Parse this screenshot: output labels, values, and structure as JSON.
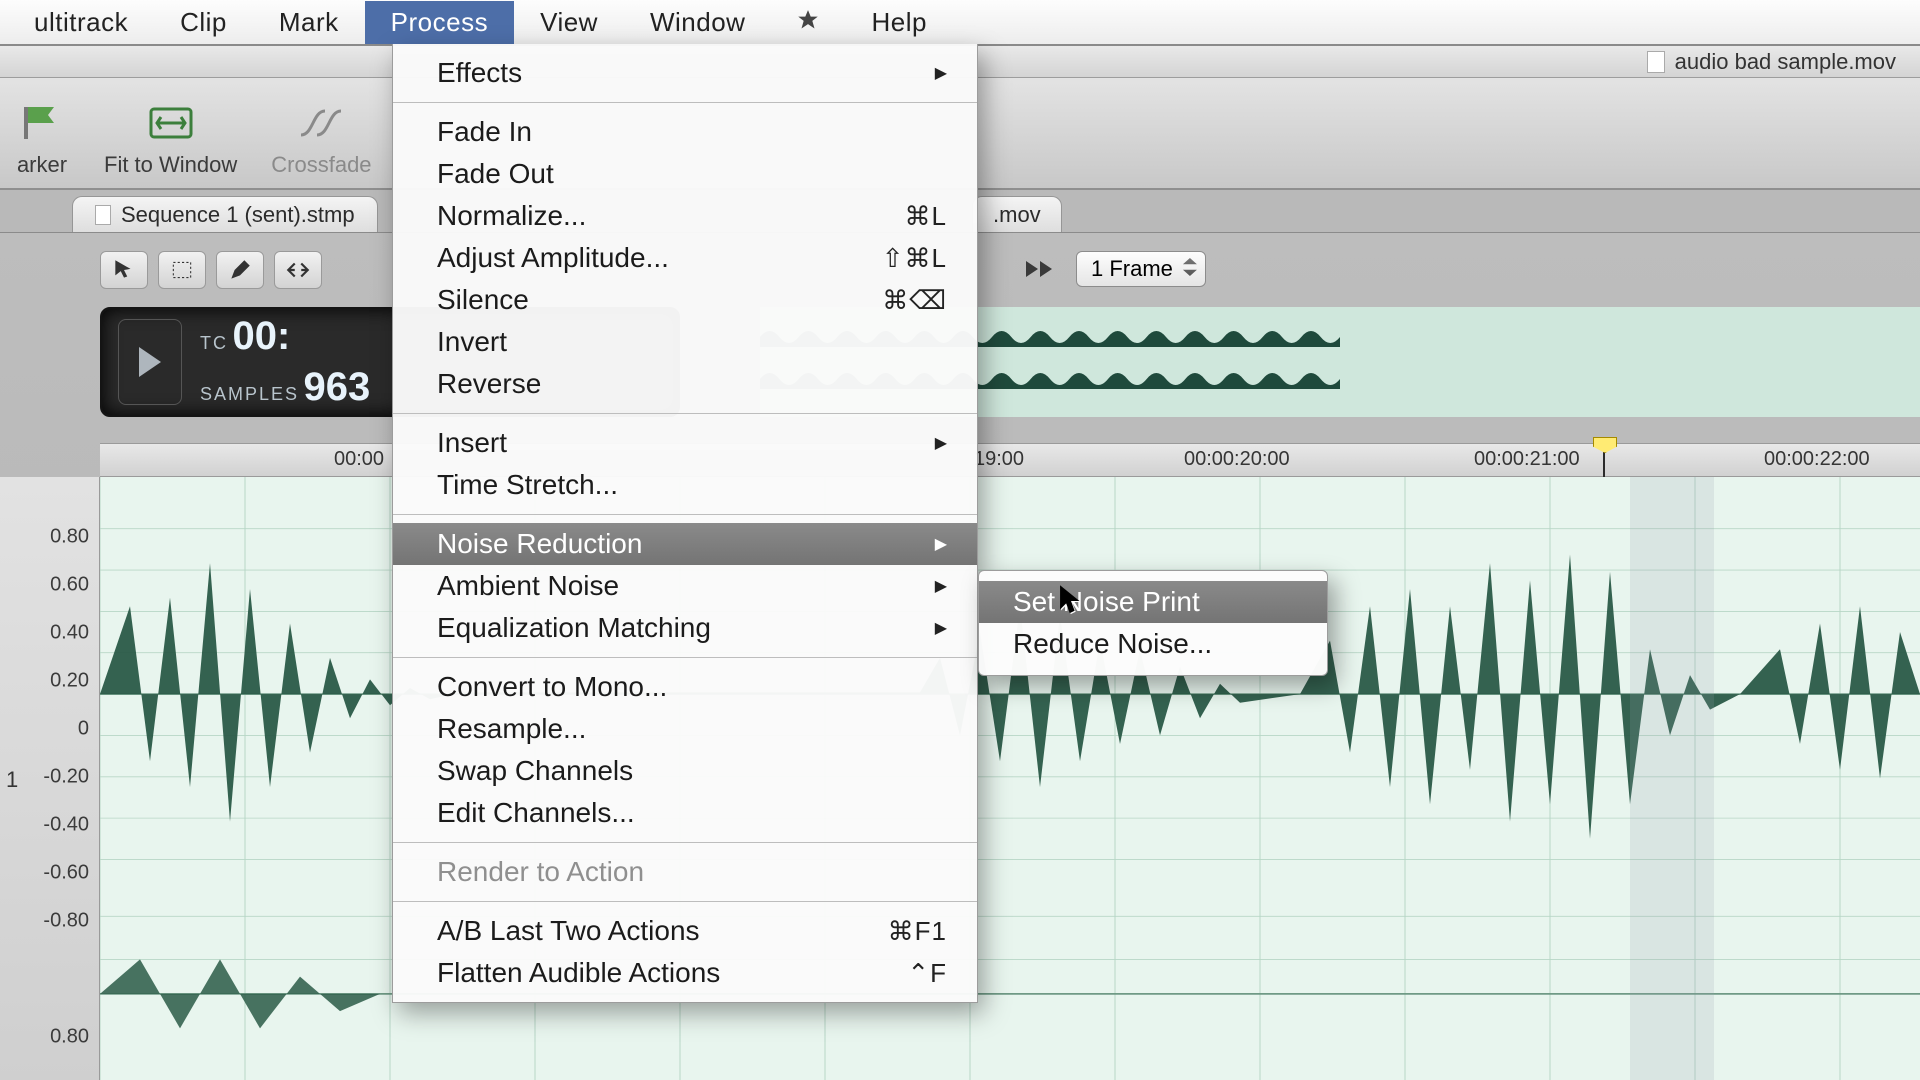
{
  "menubar": {
    "items": [
      "ultitrack",
      "Clip",
      "Mark",
      "Process",
      "View",
      "Window",
      "Help"
    ],
    "active_index": 3
  },
  "document_title": "audio bad sample.mov",
  "toolbar": {
    "buttons": [
      {
        "label": "arker",
        "icon": "flag",
        "disabled": false
      },
      {
        "label": "Fit to Window",
        "icon": "fit",
        "disabled": false
      },
      {
        "label": "Crossfade",
        "icon": "crossfade",
        "disabled": true
      }
    ]
  },
  "tabs": {
    "active_label": "Sequence 1 (sent).stmp",
    "ghost_label": ".mov"
  },
  "frame_selector": "1 Frame",
  "lcd": {
    "tc_label": "TC",
    "tc_value": "00:",
    "samples_label": "SAMPLES",
    "samples_value": "963"
  },
  "ruler": {
    "ticks": [
      "00:00",
      "19:00",
      "00:00:20:00",
      "00:00:21:00",
      "00:00:22:00"
    ]
  },
  "axis": {
    "labels": [
      "0.80",
      "0.60",
      "0.40",
      "0.20",
      "0",
      "-0.20",
      "-0.40",
      "-0.60",
      "-0.80",
      "",
      "0.80"
    ]
  },
  "channel_number": "1",
  "process_menu": {
    "items": [
      {
        "label": "Effects",
        "submenu": true
      },
      {
        "sep": true
      },
      {
        "label": "Fade In"
      },
      {
        "label": "Fade Out"
      },
      {
        "label": "Normalize...",
        "shortcut": "⌘L"
      },
      {
        "label": "Adjust Amplitude...",
        "shortcut": "⇧⌘L"
      },
      {
        "label": "Silence",
        "shortcut": "⌘⌫"
      },
      {
        "label": "Invert"
      },
      {
        "label": "Reverse"
      },
      {
        "sep": true
      },
      {
        "label": "Insert",
        "submenu": true
      },
      {
        "label": "Time Stretch..."
      },
      {
        "sep": true
      },
      {
        "label": "Noise Reduction",
        "submenu": true,
        "highlight": true
      },
      {
        "label": "Ambient Noise",
        "submenu": true
      },
      {
        "label": "Equalization Matching",
        "submenu": true
      },
      {
        "sep": true
      },
      {
        "label": "Convert to Mono..."
      },
      {
        "label": "Resample..."
      },
      {
        "label": "Swap Channels"
      },
      {
        "label": "Edit Channels..."
      },
      {
        "sep": true
      },
      {
        "label": "Render to Action",
        "disabled": true
      },
      {
        "sep": true
      },
      {
        "label": "A/B Last Two Actions",
        "shortcut": "⌘F1"
      },
      {
        "label": "Flatten Audible Actions",
        "shortcut": "⌃F"
      }
    ]
  },
  "noise_reduction_submenu": {
    "items": [
      {
        "label": "Set Noise Print",
        "highlight": true
      },
      {
        "label": "Reduce Noise..."
      }
    ]
  }
}
